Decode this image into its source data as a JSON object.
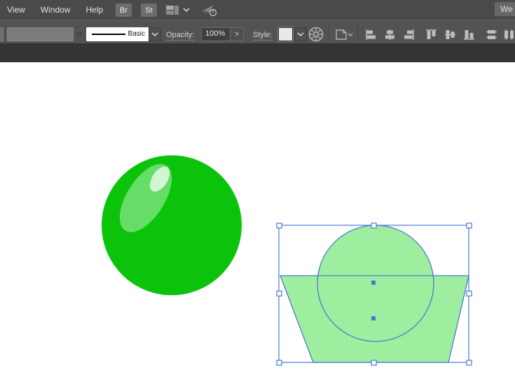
{
  "menubar": {
    "items": [
      "View",
      "Window",
      "Help"
    ],
    "bridge_label": "Br",
    "stock_label": "St",
    "workspace_label": "We"
  },
  "controlbar": {
    "brush_name": "Basic",
    "opacity_label": "Opacity:",
    "opacity_value": "100%",
    "opacity_more": ">",
    "style_label": "Style:"
  },
  "icons": {
    "workspace_switcher": "panel-layout",
    "chevron_down": "chevron-down",
    "gpu_performance": "rocket-with-power",
    "recolor_artwork": "color-wheel",
    "align_to": "artboard-document",
    "align_buttons": [
      "horizontal-align-left",
      "horizontal-align-center",
      "horizontal-align-right",
      "vertical-align-top",
      "vertical-align-center",
      "vertical-align-bottom",
      "vertical-distribute-center",
      "horizontal-distribute-center"
    ]
  },
  "theme": {
    "appbar_bg": "#4a4a4a",
    "controlbar_bg": "#535353",
    "tabstrip_bg": "#343434",
    "canvas_bg": "#ffffff",
    "icon_gray": "#bdbdbd",
    "selection_blue": "#477bd2",
    "ball_green": "#0cc30c",
    "ball_highlight_green": "#66dd66",
    "ball_glint_green": "#d2f6d2",
    "selected_fill_green": "#9fee9f",
    "handle_fill": "#ffffff"
  },
  "canvas": {
    "objects": [
      {
        "name": "glossy green ball",
        "fill": "#0cc30c"
      },
      {
        "name": "selected group: circle over trapezoid",
        "fill": "#9fee9f",
        "selected": true
      }
    ]
  }
}
